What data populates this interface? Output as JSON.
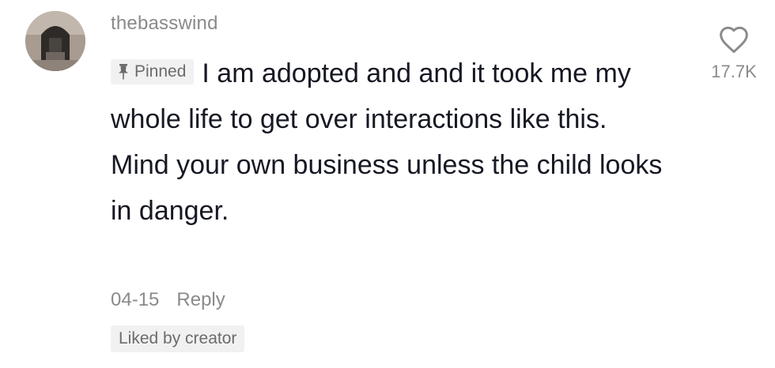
{
  "comment": {
    "username": "thebasswind",
    "avatar_icon": "user-avatar-photo",
    "pinned_label": "Pinned",
    "pin_icon": "pin-icon",
    "text": "I am adopted and and it took me my whole life to get over interactions like this. Mind your own business unless the child looks in danger.",
    "date": "04-15",
    "reply_label": "Reply",
    "liked_badge": "Liked by creator",
    "like_icon": "heart-outline-icon",
    "like_count": "17.7K"
  },
  "colors": {
    "text_primary": "#161823",
    "text_secondary": "#8a8a8a",
    "badge_bg": "#f1f1f2"
  }
}
